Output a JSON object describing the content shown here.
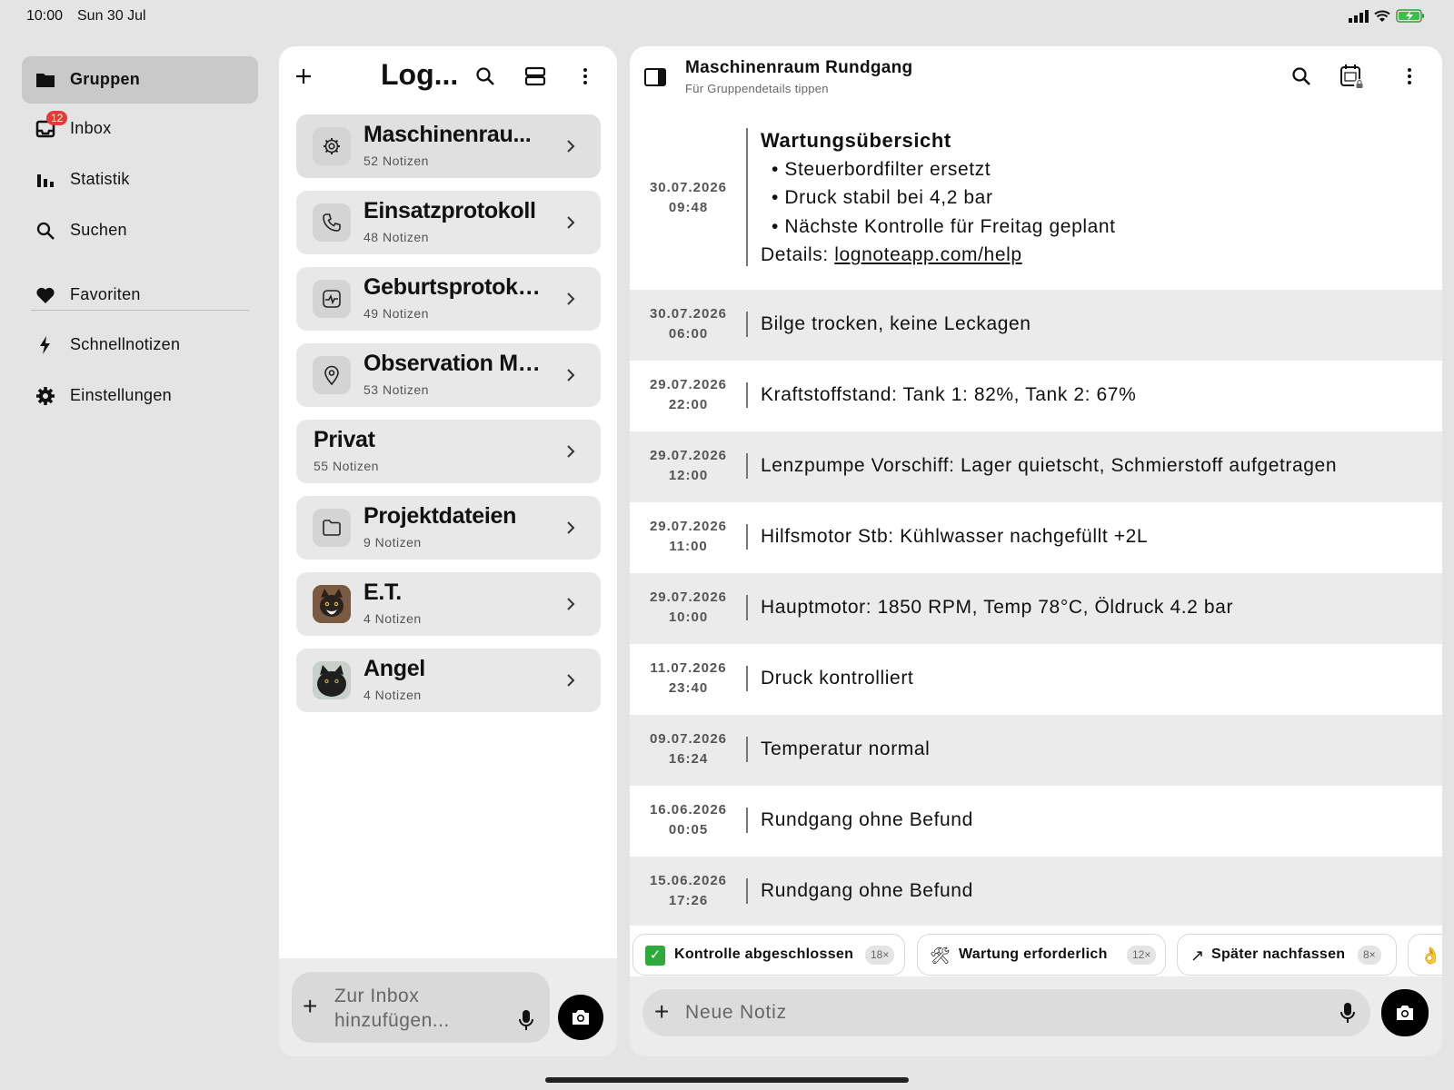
{
  "status_bar": {
    "time": "10:00",
    "date": "Sun 30 Jul"
  },
  "sidebar": {
    "items": [
      {
        "label": "Gruppen",
        "icon": "folder-icon",
        "active": true
      },
      {
        "label": "Inbox",
        "icon": "inbox-icon",
        "badge": "12"
      },
      {
        "label": "Statistik",
        "icon": "bar-chart-icon"
      },
      {
        "label": "Suchen",
        "icon": "search-icon"
      },
      {
        "label": "Favoriten",
        "icon": "heart-icon"
      },
      {
        "label": "Schnellnotizen",
        "icon": "bolt-icon"
      },
      {
        "label": "Einstellungen",
        "icon": "gear-icon"
      }
    ]
  },
  "groups_panel": {
    "title": "Log...",
    "groups": [
      {
        "name": "Maschinenrau...",
        "count": "52 Notizen",
        "icon": "gear-icon",
        "selected": true
      },
      {
        "name": "Einsatzprotokoll",
        "count": "48 Notizen",
        "icon": "phone-icon"
      },
      {
        "name": "Geburtsprotoko...",
        "count": "49 Notizen",
        "icon": "heartbeat-icon"
      },
      {
        "name": "Observation Mü...",
        "count": "53 Notizen",
        "icon": "location-pin-icon"
      },
      {
        "name": "Privat",
        "count": "55 Notizen",
        "icon": ""
      },
      {
        "name": "Projektdateien",
        "count": "9 Notizen",
        "icon": "folder-outline-icon"
      },
      {
        "name": "E.T.",
        "count": "4 Notizen",
        "icon": "cat-photo-avatar"
      },
      {
        "name": "Angel",
        "count": "4 Notizen",
        "icon": "cat-photo-avatar"
      }
    ],
    "input_placeholder": "Zur Inbox hinzufügen..."
  },
  "chat": {
    "title": "Maschinenraum Rundgang",
    "subtitle": "Für Gruppendetails tippen",
    "notes": [
      {
        "date": "30.07.2026",
        "time": "09:48",
        "title": "Wartungsübersicht",
        "lines": [
          "• Steuerbordfilter ersetzt",
          "• Druck stabil bei 4,2 bar",
          "• Nächste Kontrolle für Freitag geplant"
        ],
        "details_label": "Details: ",
        "details_link": "lognoteapp.com/help"
      },
      {
        "date": "30.07.2026",
        "time": "06:00",
        "text": "Bilge trocken, keine Leckagen"
      },
      {
        "date": "29.07.2026",
        "time": "22:00",
        "text": "Kraftstoffstand: Tank 1: 82%, Tank 2: 67%"
      },
      {
        "date": "29.07.2026",
        "time": "12:00",
        "text": "Lenzpumpe Vorschiff: Lager quietscht, Schmierstoff aufgetragen"
      },
      {
        "date": "29.07.2026",
        "time": "11:00",
        "text": "Hilfsmotor Stb: Kühlwasser nachgefüllt +2L"
      },
      {
        "date": "29.07.2026",
        "time": "10:00",
        "text": "Hauptmotor: 1850 RPM, Temp 78°C, Öldruck 4.2 bar"
      },
      {
        "date": "11.07.2026",
        "time": "23:40",
        "text": "Druck kontrolliert"
      },
      {
        "date": "09.07.2026",
        "time": "16:24",
        "text": "Temperatur normal"
      },
      {
        "date": "16.06.2026",
        "time": "00:05",
        "text": "Rundgang ohne Befund"
      },
      {
        "date": "15.06.2026",
        "time": "17:26",
        "text": "Rundgang ohne Befund"
      }
    ],
    "tags": [
      {
        "emoji": "✅",
        "label": "Kontrolle abgeschlossen",
        "count": "18×"
      },
      {
        "emoji": "🛠",
        "label": "Wartung erforderlich",
        "count": "12×"
      },
      {
        "emoji": "↗",
        "label": "Später nachfassen",
        "count": "8×"
      },
      {
        "emoji": "👌",
        "label": "",
        "count": ""
      }
    ],
    "input_placeholder": "Neue Notiz"
  }
}
